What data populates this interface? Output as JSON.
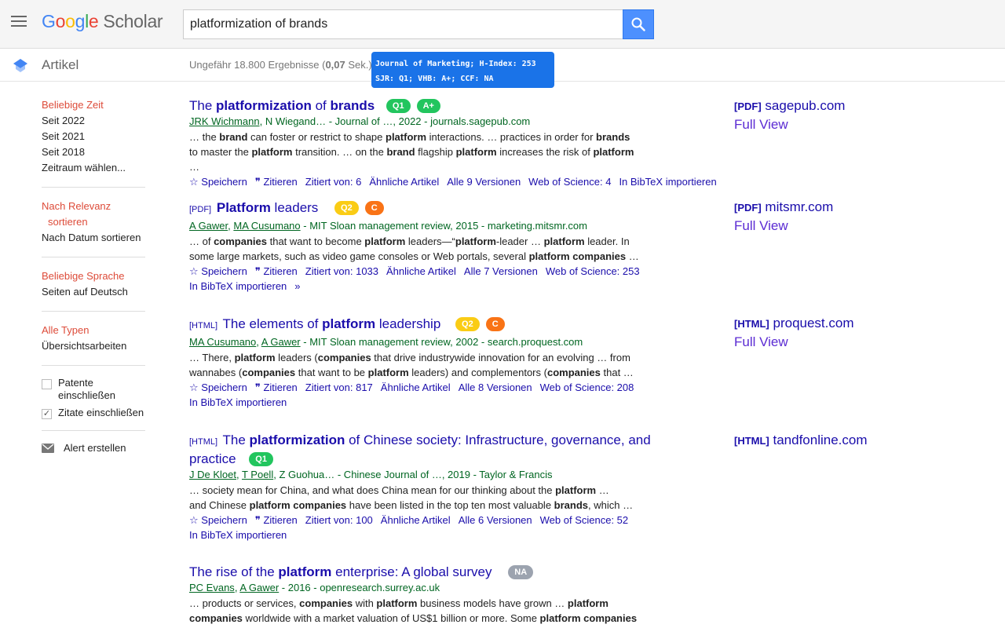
{
  "header": {
    "logo": {
      "g1": "G",
      "o1": "o",
      "o2": "o",
      "g2": "g",
      "l": "l",
      "e": "e",
      "product": "Scholar"
    },
    "search_value": "platformization of brands"
  },
  "subheader": {
    "section": "Artikel",
    "count_prefix": "Ungefähr 18.800 Ergebnisse (",
    "count_time": "0,07",
    "count_suffix": " Sek.)"
  },
  "tooltip": {
    "line1": "Journal of Marketing; H-Index: 253",
    "line2": "SJR: Q1; VHB: A+; CCF: NA"
  },
  "sidebar": {
    "time": [
      "Beliebige Zeit",
      "Seit 2022",
      "Seit 2021",
      "Seit 2018",
      "Zeitraum wählen..."
    ],
    "sort": [
      "Nach Relevanz",
      "sortieren",
      "Nach Datum sortieren"
    ],
    "lang": [
      "Beliebige Sprache",
      "Seiten auf Deutsch"
    ],
    "types": [
      "Alle Typen",
      "Übersichtsarbeiten"
    ],
    "patents": "Patente einschließen",
    "citations": "Zitate einschließen",
    "alert": "Alert erstellen"
  },
  "results": [
    {
      "tag": "",
      "title_parts": [
        "The ",
        "platformization",
        " of ",
        "brands"
      ],
      "badges": [
        "Q1",
        "A+"
      ],
      "authors": [
        "JRK Wichmann",
        "N Wiegand"
      ],
      "source": "… - Journal of …, 2022 - journals.sagepub.com",
      "snippet1": [
        "… the ",
        "brand",
        " can foster or restrict to shape ",
        "platform",
        " interactions. … practices in order for ",
        "brands"
      ],
      "snippet2": [
        "to master the ",
        "platform",
        " transition. … on the ",
        "brand",
        " flagship ",
        "platform",
        " increases the risk of ",
        "platform",
        " …"
      ],
      "links": [
        "Speichern",
        "Zitieren",
        "Zitiert von: 6",
        "Ähnliche Artikel",
        "Alle 9 Versionen",
        "Web of Science: 4",
        "In BibTeX importieren"
      ],
      "side": {
        "tag": "[PDF]",
        "domain": "sagepub.com",
        "full": "Full View"
      }
    },
    {
      "tag": "[PDF]",
      "title_parts": [
        "Platform",
        " leaders"
      ],
      "badges": [
        "Q2",
        "C"
      ],
      "authors": [
        "A Gawer",
        "MA Cusumano"
      ],
      "source": " - MIT Sloan management review, 2015 - marketing.mitsmr.com",
      "snippet1": [
        "… of ",
        "companies",
        " that want to become ",
        "platform",
        " leaders—“",
        "platform",
        "-leader … ",
        "platform",
        " leader. In"
      ],
      "snippet2": [
        "some large markets, such as video game consoles or Web portals, several ",
        "platform companies",
        " …"
      ],
      "links": [
        "Speichern",
        "Zitieren",
        "Zitiert von: 1033",
        "Ähnliche Artikel",
        "Alle 7 Versionen",
        "Web of Science: 253",
        "In BibTeX importieren"
      ],
      "side": {
        "tag": "[PDF]",
        "domain": "mitsmr.com",
        "full": "Full View"
      }
    },
    {
      "tag": "[HTML]",
      "title_parts": [
        "The elements of ",
        "platform",
        " leadership"
      ],
      "badges": [
        "Q2",
        "C"
      ],
      "authors": [
        "MA Cusumano",
        "A Gawer"
      ],
      "source": " - MIT Sloan management review, 2002 - search.proquest.com",
      "snippet1": [
        "… There, ",
        "platform",
        " leaders (",
        "companies",
        " that drive industrywide innovation for an evolving … from"
      ],
      "snippet2": [
        "wannabes (",
        "companies",
        " that want to be ",
        "platform",
        " leaders) and complementors (",
        "companies",
        " that …"
      ],
      "links": [
        "Speichern",
        "Zitieren",
        "Zitiert von: 817",
        "Ähnliche Artikel",
        "Alle 8 Versionen",
        "Web of Science: 208",
        "In BibTeX importieren"
      ],
      "side": {
        "tag": "[HTML]",
        "domain": "proquest.com",
        "full": "Full View"
      }
    },
    {
      "tag": "[HTML]",
      "title_parts": [
        "The ",
        "platformization",
        " of Chinese society: Infrastructure, governance, and",
        "practice"
      ],
      "badges": [
        "Q1"
      ],
      "authors": [
        "J De Kloet",
        "T Poell"
      ],
      "authors_extra": ", Z Guohua… - Chinese Journal of …, 2019 - Taylor & Francis",
      "snippet1": [
        "… society mean for China, and what does China mean for our thinking about the ",
        "platform",
        " …"
      ],
      "snippet2": [
        "and Chinese ",
        "platform companies",
        " have been listed in the top ten most valuable ",
        "brands",
        ", which …"
      ],
      "links": [
        "Speichern",
        "Zitieren",
        "Zitiert von: 100",
        "Ähnliche Artikel",
        "Alle 6 Versionen",
        "Web of Science: 52",
        "In BibTeX importieren"
      ],
      "side": {
        "tag": "[HTML]",
        "domain": "tandfonline.com"
      }
    },
    {
      "tag": "",
      "title_parts": [
        "The rise of the ",
        "platform",
        " enterprise: A global survey"
      ],
      "badges": [
        "NA"
      ],
      "authors": [
        "PC Evans",
        "A Gawer"
      ],
      "source": " - 2016 - openresearch.surrey.ac.uk",
      "snippet1": [
        "… products or services, ",
        "companies",
        " with ",
        "platform",
        " business models have grown … ",
        "platform"
      ],
      "snippet2": [
        "companies",
        " worldwide with a market valuation of US$1 billion or more. Some ",
        "platform companies",
        " …"
      ]
    }
  ],
  "colors": {
    "link": "#1a0dab",
    "author": "#006621",
    "selected": "#dd4b39",
    "q1": "#22c55e",
    "q2": "#facc15",
    "c": "#f97316",
    "na": "#9ca3af",
    "search_btn": "#4d90fe"
  }
}
